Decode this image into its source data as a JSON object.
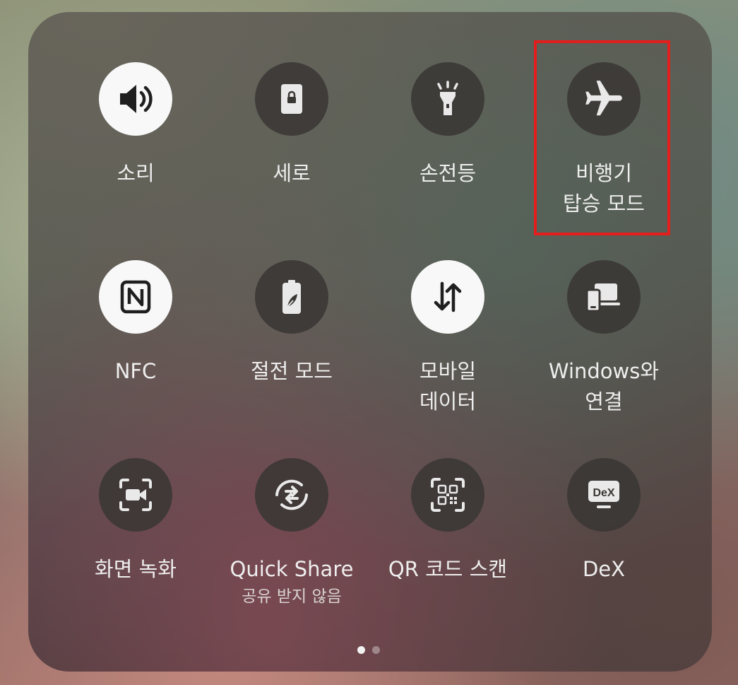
{
  "quick_panel": {
    "tiles": [
      {
        "name": "sound",
        "label": "소리",
        "state": "on",
        "icon": "speaker-icon"
      },
      {
        "name": "orientation",
        "label": "세로",
        "state": "off",
        "icon": "portrait-lock-icon"
      },
      {
        "name": "flashlight",
        "label": "손전등",
        "state": "off",
        "icon": "flashlight-icon"
      },
      {
        "name": "airplane",
        "label": "비행기\n탑승 모드",
        "line1": "비행기",
        "line2": "탑승 모드",
        "state": "off",
        "icon": "airplane-icon"
      },
      {
        "name": "nfc",
        "label": "NFC",
        "state": "on",
        "icon": "nfc-icon"
      },
      {
        "name": "power-saving",
        "label": "절전 모드",
        "state": "off",
        "icon": "battery-leaf-icon"
      },
      {
        "name": "mobile-data",
        "label": "모바일\n데이터",
        "line1": "모바일",
        "line2": "데이터",
        "state": "on",
        "icon": "data-arrows-icon"
      },
      {
        "name": "link-to-windows",
        "label": "Windows와\n연결",
        "line1": "Windows와",
        "line2": "연결",
        "state": "off",
        "icon": "devices-icon"
      },
      {
        "name": "screen-recorder",
        "label": "화면 녹화",
        "state": "off",
        "icon": "screen-record-icon"
      },
      {
        "name": "quick-share",
        "label": "Quick Share",
        "sublabel": "공유 받지 않음",
        "state": "off",
        "icon": "quick-share-icon"
      },
      {
        "name": "qr-scanner",
        "label": "QR 코드 스캔",
        "state": "off",
        "icon": "qr-code-icon"
      },
      {
        "name": "dex",
        "label": "DeX",
        "state": "off",
        "icon": "dex-icon",
        "icon_text": "DeX"
      }
    ],
    "page_indicator": {
      "pages": 2,
      "current": 1
    }
  },
  "colors": {
    "tile_on": "#f8f8f8",
    "tile_off": "#3a3734",
    "icon_on": "#1f1f1f",
    "icon_off": "#e9e9e9",
    "highlight_border": "#e41d1d"
  }
}
